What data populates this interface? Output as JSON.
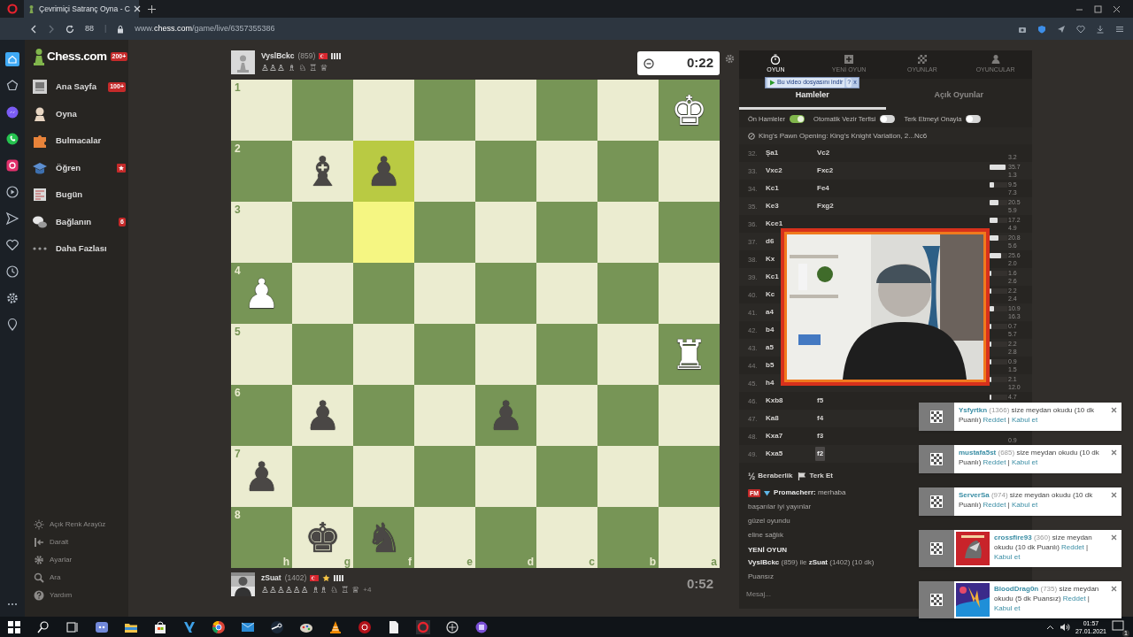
{
  "browser": {
    "tab_title": "Çevrimiçi Satranç Oyna - C",
    "page_count": "88",
    "separator": "|",
    "url": "www.**chess.com**/game/live/6357355386"
  },
  "sidebar": {
    "logo": "Chess.com",
    "logo_badge": "200+",
    "items": [
      {
        "label": "Ana Sayfa",
        "badge": {
          "kind": "count",
          "text": "100+"
        }
      },
      {
        "label": "Oyna"
      },
      {
        "label": "Bulmacalar"
      },
      {
        "label": "Öğren",
        "badge": {
          "kind": "star"
        }
      },
      {
        "label": "Bugün"
      },
      {
        "label": "Bağlanın",
        "badge": {
          "kind": "count",
          "text": "6"
        }
      },
      {
        "label": "Daha Fazlası"
      }
    ],
    "footer": [
      "Açık Renk Arayüz",
      "Daralt",
      "Ayarlar",
      "Ara",
      "Yardım"
    ]
  },
  "top_player": {
    "name": "VyslBckc",
    "rating": "(859)",
    "premium": false,
    "captured": "♙♙♙ ♗ ♘ ♖ ♕",
    "clock": "0:22",
    "clock_active": true
  },
  "board": {
    "rows": [
      {
        "label": "1",
        "cells": [
          {
            "highlighted": false
          },
          {
            "highlighted": false
          },
          {
            "highlighted": false
          },
          {
            "highlighted": false
          },
          {
            "highlighted": false
          },
          {
            "highlighted": false
          },
          {
            "highlighted": false
          },
          {
            "piece": "♚",
            "white": true,
            "highlighted": false
          }
        ]
      },
      {
        "label": "2",
        "cells": [
          {
            "highlighted": false
          },
          {
            "piece": "♝",
            "white": false,
            "highlighted": false
          },
          {
            "piece": "♟",
            "white": false,
            "highlighted": true
          },
          {
            "highlighted": false
          },
          {
            "highlighted": false
          },
          {
            "highlighted": false
          },
          {
            "highlighted": false
          },
          {
            "highlighted": false
          }
        ]
      },
      {
        "label": "3",
        "cells": [
          {
            "highlighted": false
          },
          {
            "highlighted": false
          },
          {
            "highlighted": true
          },
          {
            "highlighted": false
          },
          {
            "highlighted": false
          },
          {
            "highlighted": false
          },
          {
            "highlighted": false
          },
          {
            "highlighted": false
          }
        ]
      },
      {
        "label": "4",
        "cells": [
          {
            "piece": "♟",
            "white": true,
            "highlighted": false
          },
          {
            "highlighted": false
          },
          {
            "highlighted": false
          },
          {
            "highlighted": false
          },
          {
            "highlighted": false
          },
          {
            "highlighted": false
          },
          {
            "highlighted": false
          },
          {
            "highlighted": false
          }
        ]
      },
      {
        "label": "5",
        "cells": [
          {
            "highlighted": false
          },
          {
            "highlighted": false
          },
          {
            "highlighted": false
          },
          {
            "highlighted": false
          },
          {
            "highlighted": false
          },
          {
            "highlighted": false
          },
          {
            "highlighted": false
          },
          {
            "piece": "♜",
            "white": true,
            "highlighted": false
          }
        ]
      },
      {
        "label": "6",
        "cells": [
          {
            "highlighted": false
          },
          {
            "piece": "♟",
            "white": false,
            "highlighted": false
          },
          {
            "highlighted": false
          },
          {
            "highlighted": false
          },
          {
            "piece": "♟",
            "white": false,
            "highlighted": false
          },
          {
            "highlighted": false
          },
          {
            "highlighted": false
          },
          {
            "highlighted": false
          }
        ]
      },
      {
        "label": "7",
        "cells": [
          {
            "piece": "♟",
            "white": false,
            "highlighted": false
          },
          {
            "highlighted": false
          },
          {
            "highlighted": false
          },
          {
            "highlighted": false
          },
          {
            "highlighted": false
          },
          {
            "highlighted": false
          },
          {
            "highlighted": false
          },
          {
            "highlighted": false
          }
        ]
      },
      {
        "label": "8",
        "cells": [
          {
            "highlighted": false
          },
          {
            "piece": "♚",
            "white": false,
            "highlighted": false
          },
          {
            "piece": "♞",
            "white": false,
            "highlighted": false
          },
          {
            "highlighted": false
          },
          {
            "highlighted": false
          },
          {
            "highlighted": false
          },
          {
            "highlighted": false
          },
          {
            "highlighted": false
          }
        ]
      }
    ],
    "files": [
      "h",
      "g",
      "f",
      "e",
      "d",
      "c",
      "b",
      "a"
    ]
  },
  "bottom_player": {
    "name": "zSuat",
    "rating": "(1402)",
    "premium": true,
    "captured": "♙♙♙♙♙♙ ♗♗ ♘ ♖ ♕",
    "extra": "+4",
    "clock": "0:52",
    "clock_active": false
  },
  "panel": {
    "nav": [
      {
        "label": "OYUN",
        "selected": true
      },
      {
        "label": "YENİ OYUN",
        "selected": false
      },
      {
        "label": "OYUNLAR",
        "selected": false
      },
      {
        "label": "OYUNCULAR",
        "selected": false
      }
    ],
    "download_bar": {
      "label": "Bu video dosyasını indir",
      "help": "?",
      "close": "x"
    },
    "subtabs": [
      {
        "label": "Hamleler",
        "selected": true
      },
      {
        "label": "Açık Oyunlar",
        "selected": false
      }
    ],
    "toggles": [
      {
        "label": "Ön Hamleler",
        "on": true
      },
      {
        "label": "Otomatik Vezir Terfisi",
        "on": false
      },
      {
        "label": "Terk Etmeyi Onayla",
        "on": false
      }
    ],
    "opening": "King's Pawn Opening: King's Knight Variation, 2...Nc6",
    "moves": [
      {
        "number": "32.",
        "white": "Şa1",
        "black": "Vc2",
        "selected": false,
        "time_black": "3.2"
      },
      {
        "number": "33.",
        "white": "Vxc2",
        "black": "Fxc2",
        "selected": false,
        "level": 0.9,
        "time_white": "35.7",
        "time_black": "1.3"
      },
      {
        "number": "34.",
        "white": "Kc1",
        "black": "Fe4",
        "selected": false,
        "level": 0.24,
        "time_white": "9.5",
        "time_black": "7.3"
      },
      {
        "number": "35.",
        "white": "Ke3",
        "black": "Fxg2",
        "selected": false,
        "level": 0.5,
        "time_white": "20.5",
        "time_black": "5.9"
      },
      {
        "number": "36.",
        "white": "Kce1",
        "selected": false,
        "level": 0.43,
        "time_white": "17.2",
        "time_black": "4.9"
      },
      {
        "number": "37.",
        "white": "d6",
        "selected": false,
        "level": 0.52,
        "time_white": "20.8",
        "time_black": "5.6"
      },
      {
        "number": "38.",
        "white": "Kx",
        "selected": false,
        "level": 0.64,
        "time_white": "25.6",
        "time_black": "2.0"
      },
      {
        "number": "39.",
        "white": "Kc1",
        "selected": false,
        "level": 0.05,
        "time_white": "1.6",
        "time_black": "2.6"
      },
      {
        "number": "40.",
        "white": "Kc",
        "selected": false,
        "level": 0.06,
        "time_white": "2.2",
        "time_black": "2.4"
      },
      {
        "number": "41.",
        "white": "a4",
        "selected": false,
        "level": 0.27,
        "time_white": "10.9",
        "time_black": "16.3"
      },
      {
        "number": "42.",
        "white": "b4",
        "selected": false,
        "level": 0.03,
        "time_white": "0.7",
        "time_black": "5.7"
      },
      {
        "number": "43.",
        "white": "a5",
        "selected": false,
        "level": 0.06,
        "time_white": "2.2",
        "time_black": "2.8"
      },
      {
        "number": "44.",
        "white": "b5",
        "selected": false,
        "level": 0.03,
        "time_white": "0.9",
        "time_black": "1.5"
      },
      {
        "number": "45.",
        "white": "h4",
        "selected": false,
        "level": 0.06,
        "time_white": "2.1",
        "time_black": "12.0"
      },
      {
        "number": "46.",
        "white": "Kxb8",
        "black": "f5",
        "selected": false,
        "level": 0.12,
        "time_white": "4.7"
      },
      {
        "number": "47.",
        "white": "Ka8",
        "black": "f4",
        "selected": false
      },
      {
        "number": "48.",
        "white": "Kxa7",
        "black": "f3",
        "selected": false,
        "time_black": "0.9"
      },
      {
        "number": "49.",
        "white": "Kxa5",
        "black": "f2",
        "selected": true
      }
    ],
    "actions": {
      "draw_symbol": "½",
      "draw": "Beraberlik",
      "resign": "Terk Et"
    },
    "chat": [
      {
        "kind": "user",
        "badge": "FM",
        "text": "**Promacherr:** merhaba"
      },
      {
        "kind": "plain",
        "text": "başarılar iyi yayınlar"
      },
      {
        "kind": "plain",
        "text": "güzel oyundu"
      },
      {
        "kind": "plain",
        "text": "eline sağlık"
      },
      {
        "kind": "heading",
        "text": "YENİ OYUN"
      },
      {
        "kind": "plain",
        "text": "**VyslBckc** (859) ile **zSuat** (1402) (10 dk)"
      },
      {
        "kind": "plain",
        "text": "Puansız"
      }
    ],
    "message_placeholder": "Mesaj..."
  },
  "notifications": [
    {
      "name": "Ysfyrtkn",
      "rating": "(1366)",
      "text": "size meydan okudu (10 dk Puanlı)",
      "decline": "Reddet",
      "separator": "|",
      "accept": "Kabul et",
      "avatar": false
    },
    {
      "name": "mustafa5st",
      "rating": "(685)",
      "text": "size meydan okudu (10 dk Puanlı)",
      "decline": "Reddet",
      "separator": "|",
      "accept": "Kabul et",
      "avatar": false
    },
    {
      "name": "ServerSa",
      "rating": "(974)",
      "text": "size meydan okudu (10 dk Puanlı)",
      "decline": "Reddet",
      "separator": "|",
      "accept": "Kabul et",
      "avatar": false
    },
    {
      "name": "crossfire93",
      "rating": "(360)",
      "text": "size meydan okudu (10 dk Puanlı)",
      "decline": "Reddet",
      "separator": "|",
      "accept": "Kabul et",
      "avatar": true
    },
    {
      "name": "BloodDrag0n",
      "rating": "(735)",
      "text": "size meydan okudu (5 dk Puansız)",
      "decline": "Reddet",
      "separator": "|",
      "accept": "Kabul et",
      "avatar": true
    }
  ],
  "taskbar": {
    "time": "01:57",
    "date": "27.01.2021",
    "notification_count": "1"
  }
}
